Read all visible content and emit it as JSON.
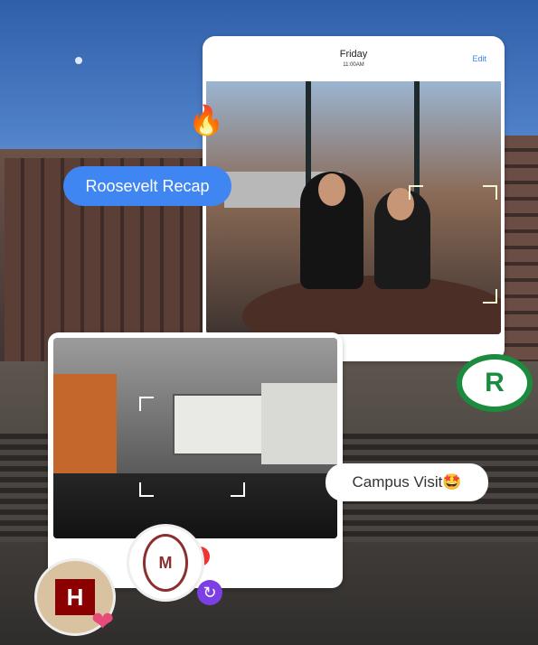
{
  "card_top": {
    "day": "Friday",
    "time": "11:00AM",
    "edit_label": "Edit"
  },
  "stickers": {
    "roosevelt_recap": "Roosevelt Recap",
    "campus_visit": "Campus Visit🤩",
    "fire_emoji": "🔥",
    "heart_emoji": "❤",
    "logo_text": "R",
    "seal_text": "M",
    "h_badge_text": "H",
    "refresh_symbol": "↻"
  },
  "colors": {
    "accent_blue": "#3f86f3",
    "edit_blue": "#3b82f6",
    "purple_badge": "#7b3fe4",
    "logo_green": "#1b8b3d"
  }
}
